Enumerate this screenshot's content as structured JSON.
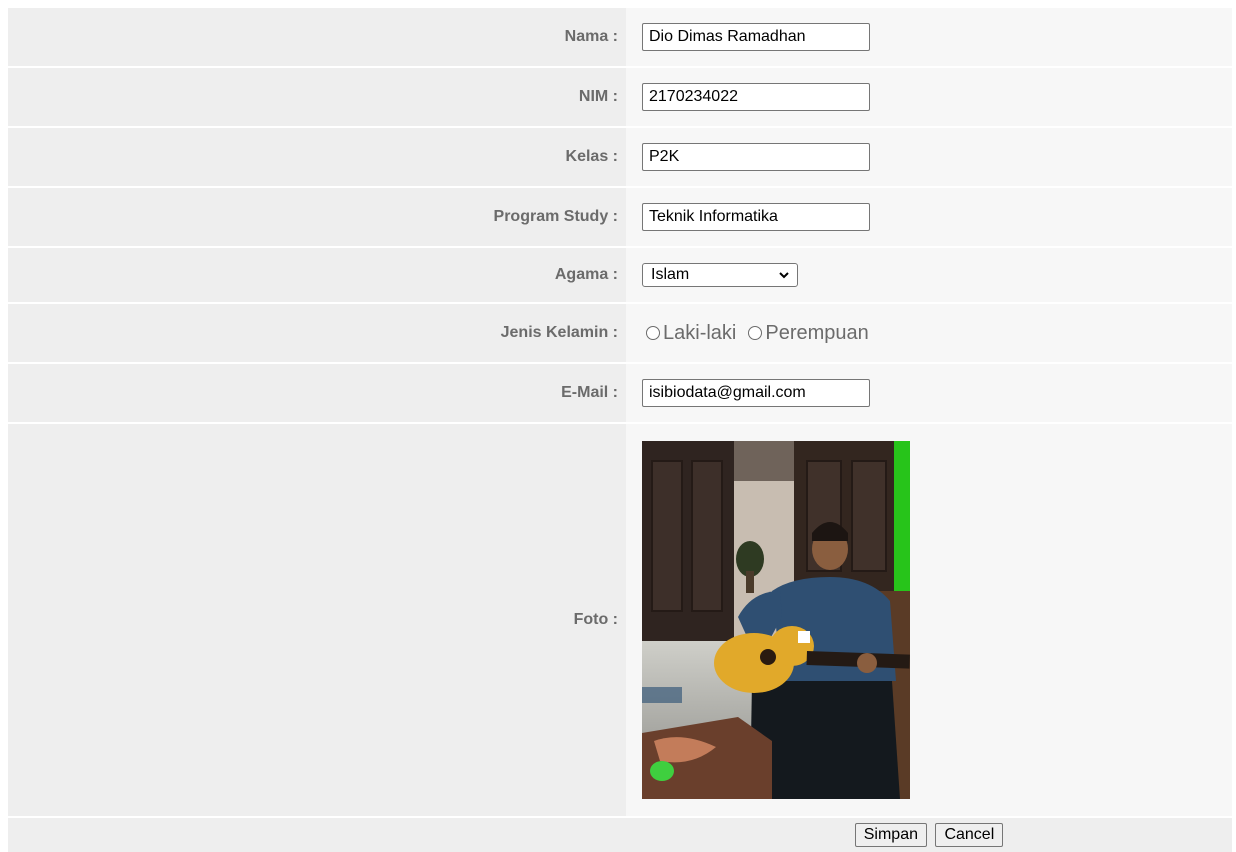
{
  "form": {
    "nama": {
      "label": "Nama :",
      "value": "Dio Dimas Ramadhan"
    },
    "nim": {
      "label": "NIM :",
      "value": "2170234022"
    },
    "kelas": {
      "label": "Kelas :",
      "value": "P2K"
    },
    "program_study": {
      "label": "Program Study :",
      "value": "Teknik Informatika"
    },
    "agama": {
      "label": "Agama :",
      "selected": "Islam"
    },
    "jenis_kelamin": {
      "label": "Jenis Kelamin :",
      "options": [
        "Laki-laki",
        "Perempuan"
      ]
    },
    "email": {
      "label": "E-Mail :",
      "value": "isibiodata@gmail.com"
    },
    "foto": {
      "label": "Foto :"
    }
  },
  "buttons": {
    "simpan": "Simpan",
    "cancel": "Cancel"
  },
  "colors": {
    "label_bg": "#eeeeee",
    "value_bg": "#f7f7f7",
    "label_text": "#6b6b6b"
  }
}
